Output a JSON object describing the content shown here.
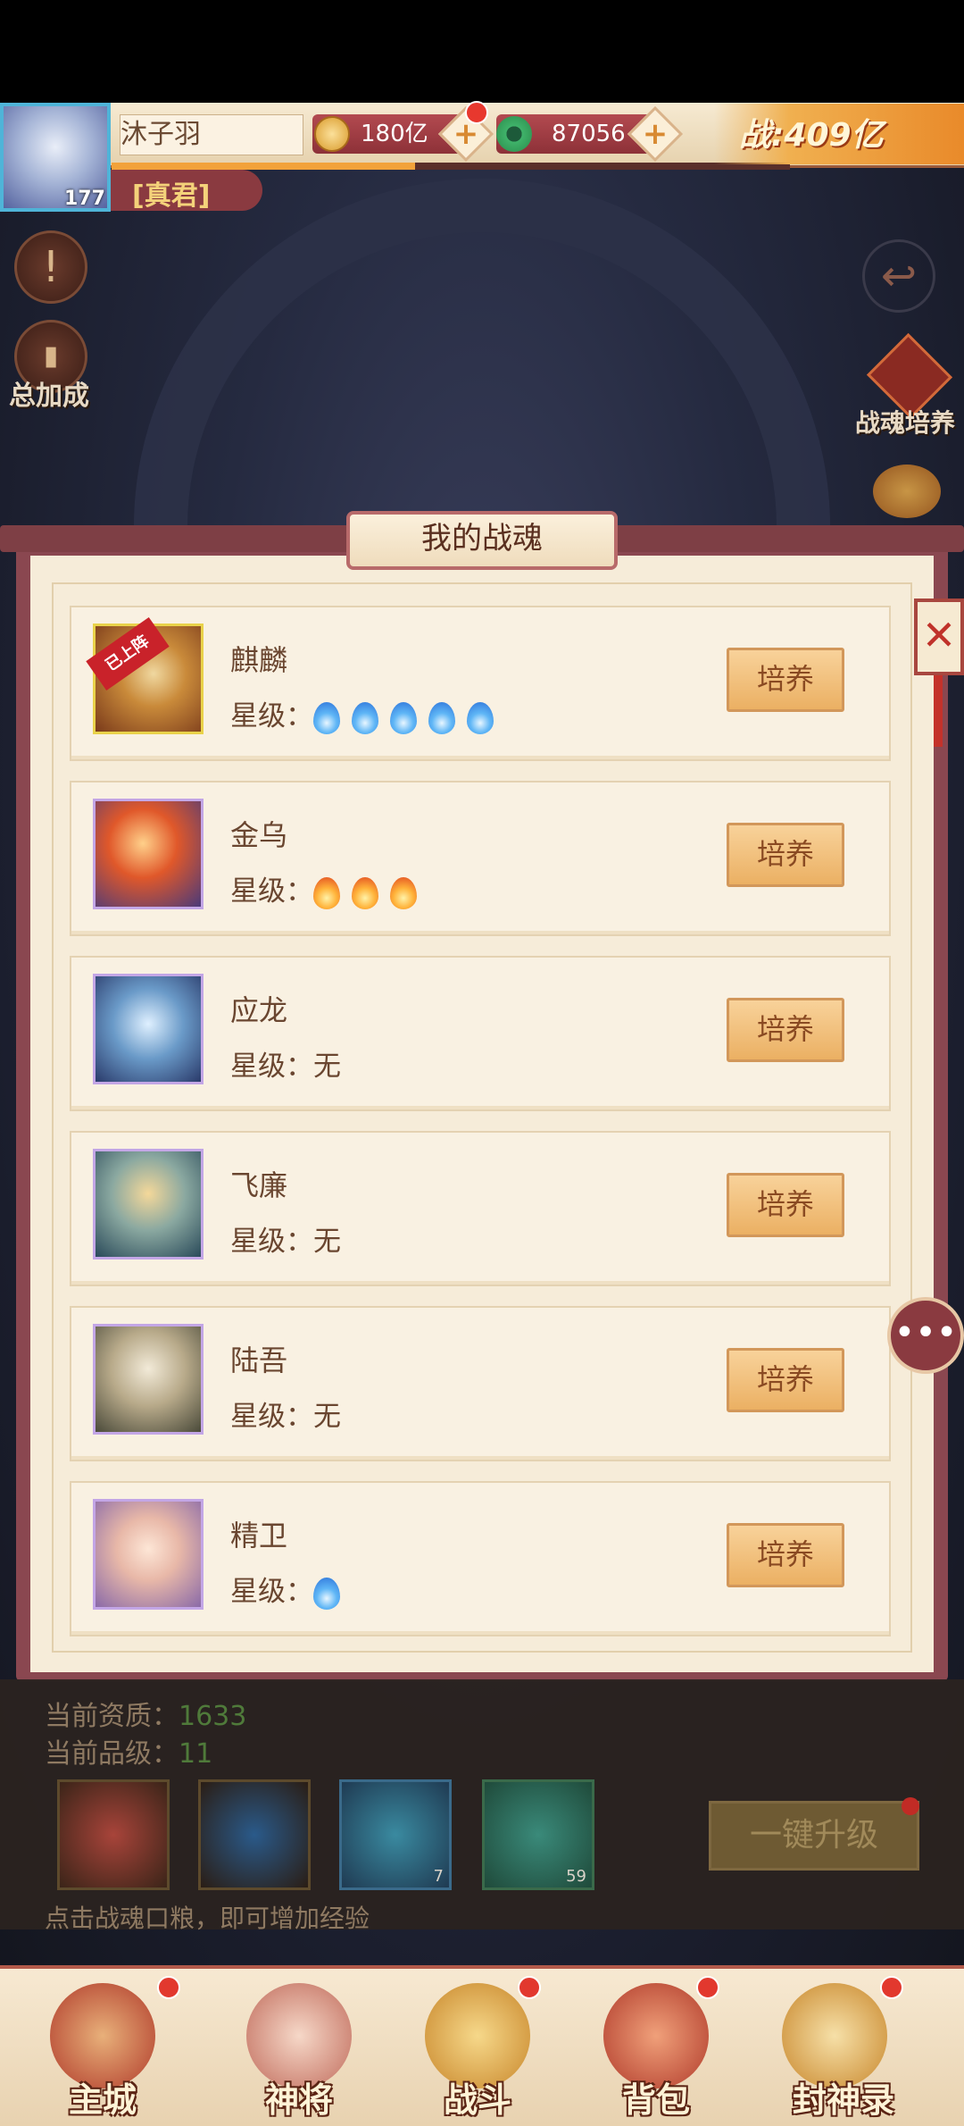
{
  "header": {
    "avatar_level": "177",
    "player_name": "沐子羽",
    "title": "[真君]",
    "gold_amount": "180亿",
    "jade_amount": "87056",
    "add_symbol": "+",
    "power": "战:409亿"
  },
  "side": {
    "notice_icon": "!",
    "total_bonus_label": "总加成",
    "back_icon": "↩",
    "soul_training_label": "战魂培养"
  },
  "panel": {
    "title": "我的战魂",
    "close_symbol": "✕",
    "equipped_ribbon": "已上阵",
    "star_prefix": "星级：",
    "train_label": "培养",
    "souls": [
      {
        "name": "麒麟",
        "stars": 5,
        "star_type": "blue",
        "star_text": ""
      },
      {
        "name": "金乌",
        "stars": 3,
        "star_type": "fire",
        "star_text": ""
      },
      {
        "name": "应龙",
        "stars": 0,
        "star_type": "none",
        "star_text": "无"
      },
      {
        "name": "飞廉",
        "stars": 0,
        "star_type": "none",
        "star_text": "无"
      },
      {
        "name": "陆吾",
        "stars": 0,
        "star_type": "none",
        "star_text": "无"
      },
      {
        "name": "精卫",
        "stars": 1,
        "star_type": "blue",
        "star_text": ""
      }
    ]
  },
  "info": {
    "aptitude_label": "当前资质：",
    "aptitude_value": "1633",
    "grade_label": "当前品级：",
    "grade_value": "11",
    "items": [
      {
        "count": ""
      },
      {
        "count": ""
      },
      {
        "count": "7"
      },
      {
        "count": "59"
      }
    ],
    "upgrade_button": "一键升级",
    "hint": "点击战魂口粮，即可增加经验"
  },
  "nav": {
    "items": [
      {
        "label": "主城"
      },
      {
        "label": "神将"
      },
      {
        "label": "战斗"
      },
      {
        "label": "背包"
      },
      {
        "label": "封神录"
      }
    ]
  },
  "colors": {
    "accent": "#8a4750",
    "button": "#ebb063",
    "panel_bg": "#f6ecd9"
  }
}
